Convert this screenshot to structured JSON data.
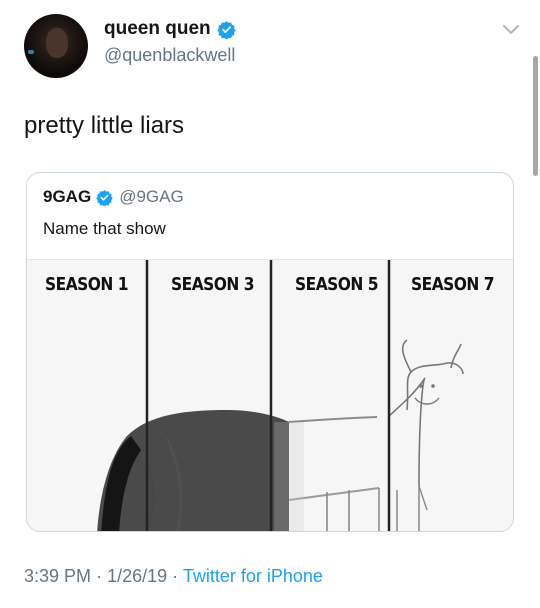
{
  "author": {
    "display_name": "queen quen",
    "handle": "@quenblackwell",
    "avatar_icon": "user-avatar",
    "verified_icon": "verified-badge-icon"
  },
  "tweet": {
    "text": "pretty little liars"
  },
  "quoted_tweet": {
    "display_name": "9GAG",
    "handle": "@9GAG",
    "text": "Name that show",
    "media": {
      "panels": [
        "SEASON 1",
        "SEASON 3",
        "SEASON 5",
        "SEASON 7"
      ]
    }
  },
  "meta": {
    "time": "3:39 PM",
    "date": "1/26/19",
    "source": "Twitter for iPhone",
    "separator": "·"
  },
  "colors": {
    "text": "#14171a",
    "secondary": "#657786",
    "link": "#1da1f2",
    "border": "#ccd6dd"
  }
}
